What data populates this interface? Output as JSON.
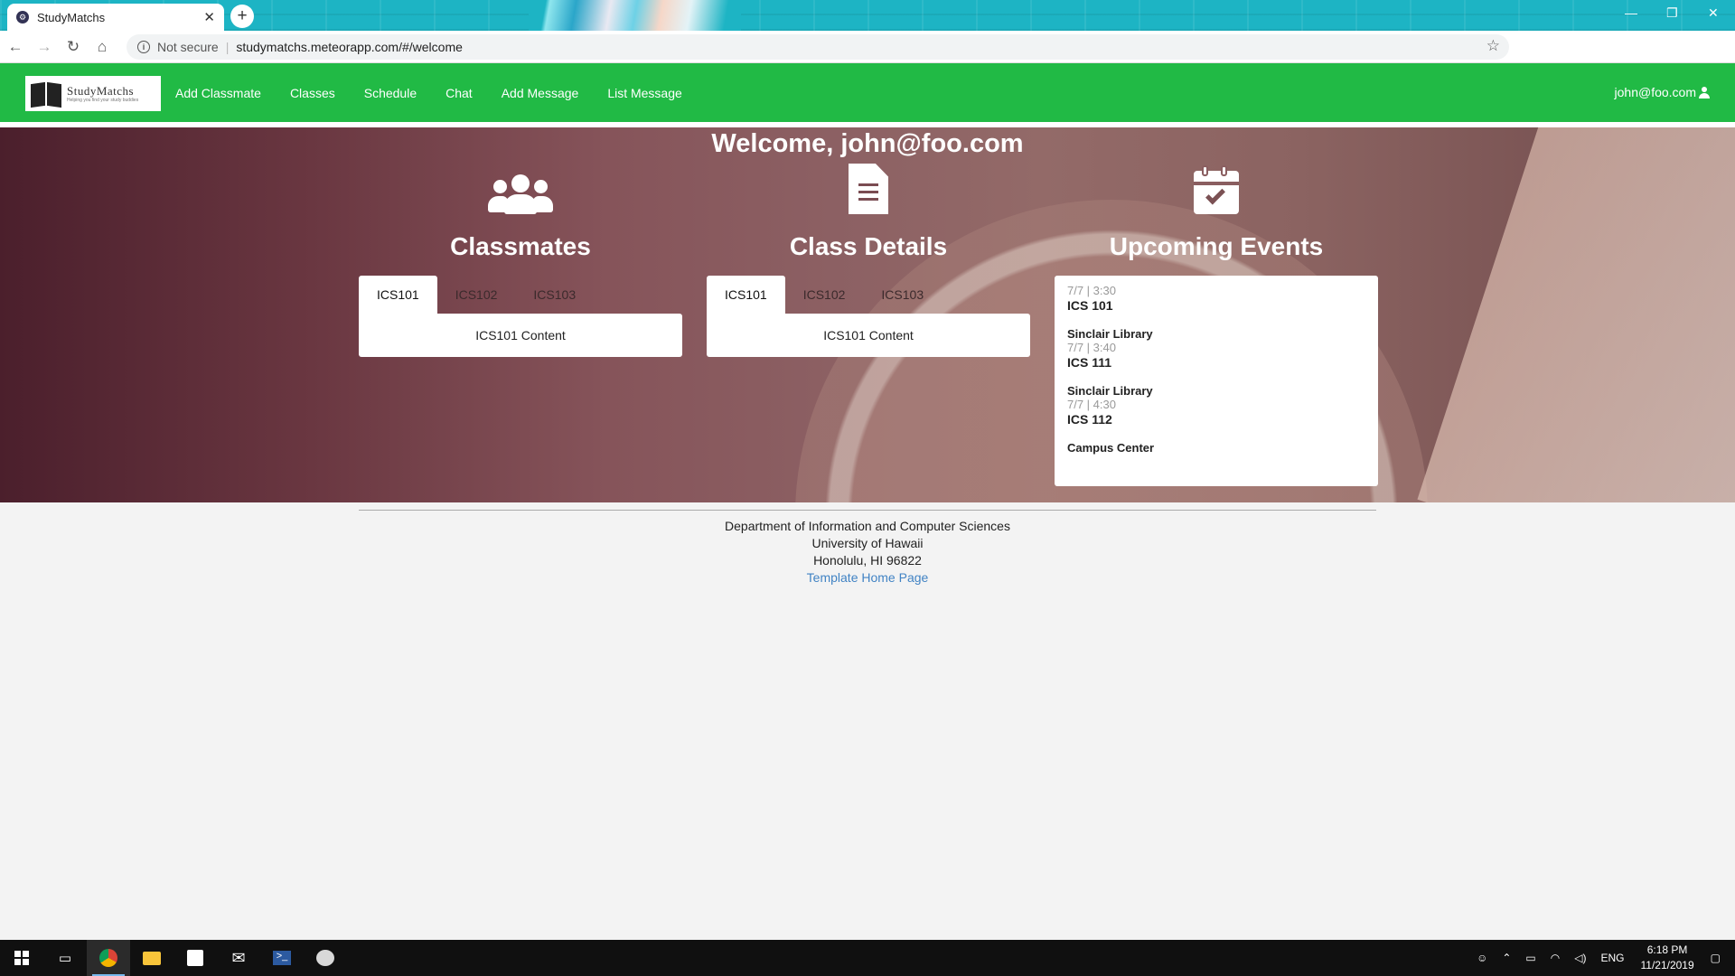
{
  "browser": {
    "tab_title": "StudyMatchs",
    "close_glyph": "✕",
    "new_tab_glyph": "+",
    "security_label": "Not secure",
    "url": "studymatchs.meteorapp.com/#/welcome"
  },
  "navbar": {
    "logo_brand": "StudyMatchs",
    "logo_tagline": "Helping you find your study buddies",
    "items": [
      {
        "label": "Add Classmate"
      },
      {
        "label": "Classes"
      },
      {
        "label": "Schedule"
      },
      {
        "label": "Chat"
      },
      {
        "label": "Add Message"
      },
      {
        "label": "List Message"
      }
    ],
    "user": "john@foo.com"
  },
  "hero": {
    "welcome": "Welcome, john@foo.com",
    "classmates": {
      "heading": "Classmates",
      "tabs": [
        "ICS101",
        "ICS102",
        "ICS103"
      ],
      "active_tab": "ICS101",
      "content": "ICS101 Content"
    },
    "class_details": {
      "heading": "Class Details",
      "tabs": [
        "ICS101",
        "ICS102",
        "ICS103"
      ],
      "active_tab": "ICS101",
      "content": "ICS101 Content"
    },
    "events": {
      "heading": "Upcoming Events",
      "items": [
        {
          "date": "7/7 | 3:30",
          "name": "ICS 101",
          "location": "Sinclair Library"
        },
        {
          "date": "7/7 | 3:40",
          "name": "ICS 111",
          "location": "Sinclair Library"
        },
        {
          "date": "7/7 | 4:30",
          "name": "ICS 112",
          "location": "Campus Center"
        }
      ]
    }
  },
  "footer": {
    "line1": "Department of Information and Computer Sciences",
    "line2": "University of Hawaii",
    "line3": "Honolulu, HI 96822",
    "link": "Template Home Page"
  },
  "taskbar": {
    "language": "ENG",
    "time": "6:18 PM",
    "date": "11/21/2019"
  },
  "colors": {
    "navbar_green": "#21ba45",
    "link_blue": "#4183c4",
    "chrome_frame": "#1db4c4"
  }
}
